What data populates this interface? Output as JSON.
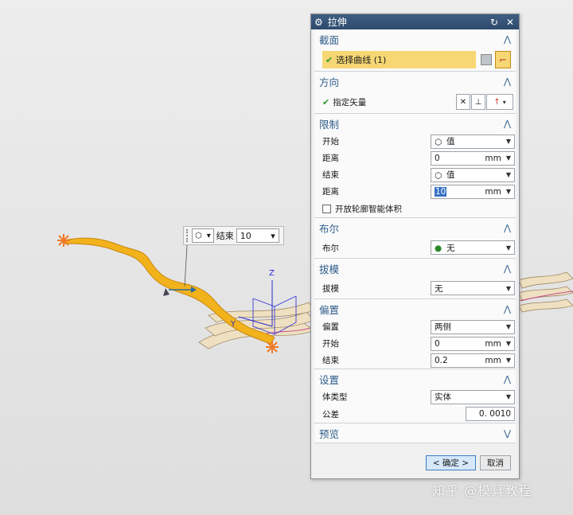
{
  "dialog": {
    "title": "拉伸",
    "sections": {
      "section": {
        "header": "截面",
        "select_curve": "选择曲线 (1)"
      },
      "direction": {
        "header": "方向",
        "specify_vector": "指定矢量"
      },
      "limits": {
        "header": "限制",
        "start_label": "开始",
        "start_value": "值",
        "distance1_label": "距离",
        "distance1_value": "0",
        "distance1_unit": "mm",
        "end_label": "结束",
        "end_value": "值",
        "distance2_label": "距离",
        "distance2_value": "10",
        "distance2_unit": "mm",
        "open_profile_label": "开放轮廓智能体积"
      },
      "boolean": {
        "header": "布尔",
        "label": "布尔",
        "value": "无"
      },
      "draft": {
        "header": "拔模",
        "label": "拔模",
        "value": "无"
      },
      "offset": {
        "header": "偏置",
        "offset_label": "偏置",
        "offset_value": "两侧",
        "start_label": "开始",
        "start_value": "0",
        "start_unit": "mm",
        "end_label": "结束",
        "end_value": "0.2",
        "end_unit": "mm"
      },
      "settings": {
        "header": "设置",
        "body_type_label": "体类型",
        "body_type_value": "实体",
        "tolerance_label": "公差",
        "tolerance_value": "0. 0010"
      },
      "preview": {
        "header": "预览"
      }
    },
    "ok_label": "< 确定 >",
    "cancel_label": "取消"
  },
  "mini_toolbar": {
    "end_label": "结束",
    "end_value": "10"
  },
  "viewport": {
    "axis_z": "Z",
    "axis_y": "Y"
  },
  "watermark": "知乎 @模具教程",
  "colors": {
    "accent": "#2f5d8a",
    "highlight": "#f7d774",
    "curve": "#f2b21c",
    "selection": "#3670c4"
  }
}
